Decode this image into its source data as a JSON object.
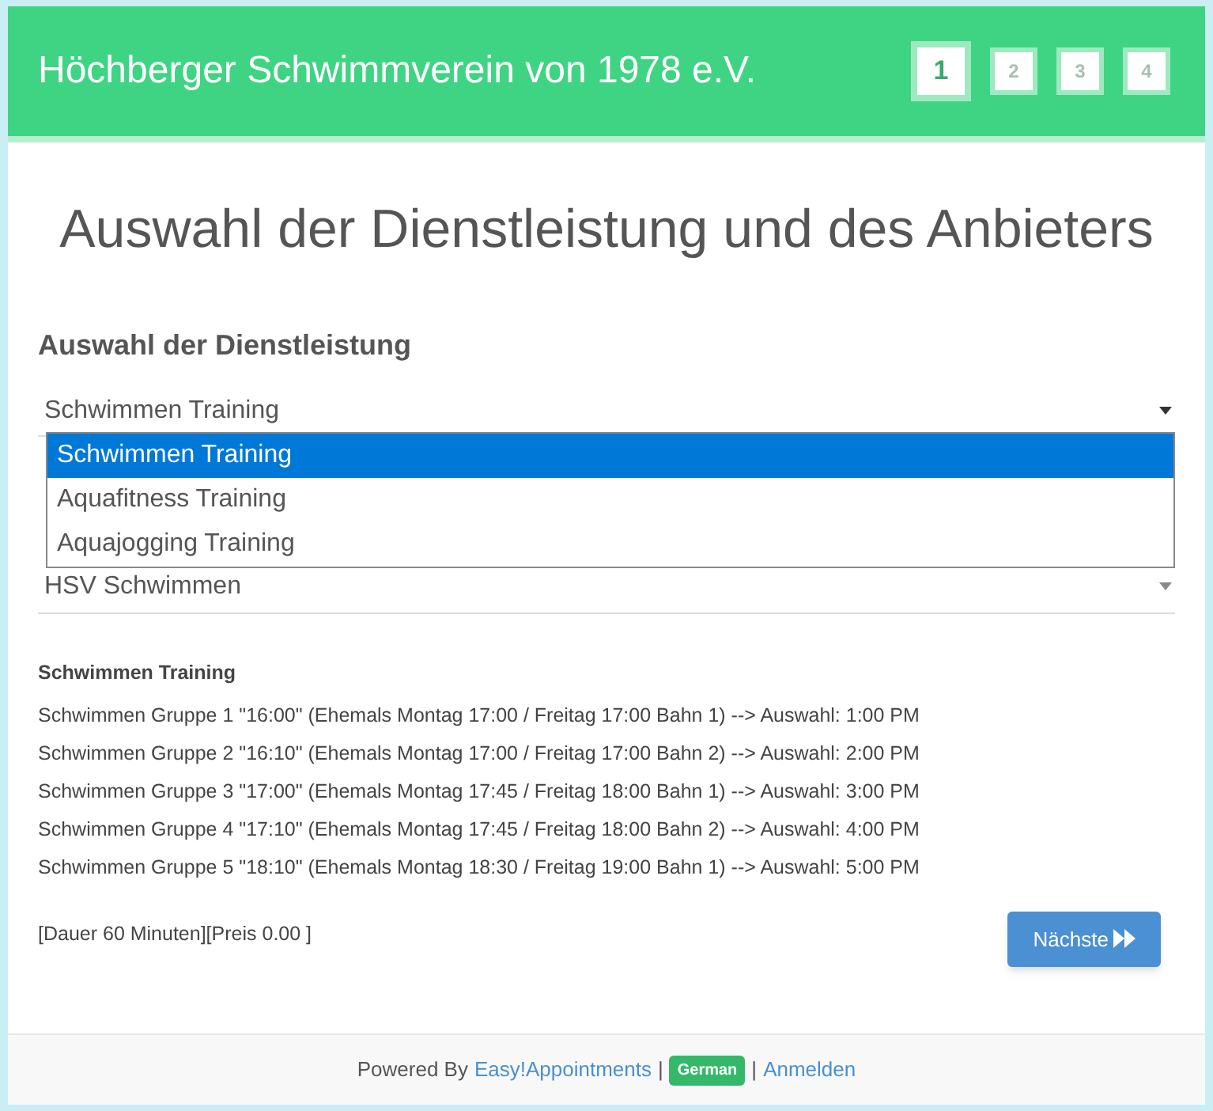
{
  "header": {
    "title": "Höchberger Schwimmverein von 1978 e.V.",
    "steps": [
      {
        "label": "1",
        "selected": true
      },
      {
        "label": "2",
        "selected": false
      },
      {
        "label": "3",
        "selected": false
      },
      {
        "label": "4",
        "selected": false
      }
    ]
  },
  "page_title": "Auswahl der Dienstleistung und des Anbieters",
  "service": {
    "heading": "Auswahl der Dienstleistung",
    "value": "Schwimmen Training",
    "options": [
      {
        "label": "Schwimmen Training",
        "selected": true
      },
      {
        "label": "Aquafitness Training",
        "selected": false
      },
      {
        "label": "Aquajogging Training",
        "selected": false
      }
    ]
  },
  "provider": {
    "value": "HSV Schwimmen"
  },
  "details": {
    "title": "Schwimmen Training",
    "lines": [
      "Schwimmen Gruppe 1 \"16:00\" (Ehemals Montag 17:00 / Freitag 17:00 Bahn 1) --> Auswahl: 1:00 PM",
      "Schwimmen Gruppe 2 \"16:10\" (Ehemals Montag 17:00 / Freitag 17:00 Bahn 2) --> Auswahl: 2:00 PM",
      "Schwimmen Gruppe 3 \"17:00\" (Ehemals Montag 17:45 / Freitag 18:00 Bahn 1) --> Auswahl: 3:00 PM",
      "Schwimmen Gruppe 4 \"17:10\" (Ehemals Montag 17:45 / Freitag 18:00 Bahn 2) --> Auswahl: 4:00 PM",
      "Schwimmen Gruppe 5 \"18:10\" (Ehemals Montag 18:30 / Freitag 19:00 Bahn 1) --> Auswahl: 5:00 PM"
    ],
    "duration_price": "[Dauer 60 Minuten][Preis 0.00 ]"
  },
  "next_button": {
    "label": "Nächste"
  },
  "footer": [
    {
      "kind": "text",
      "text": "Powered By"
    },
    {
      "kind": "link",
      "text": "Easy!Appointments"
    },
    {
      "kind": "text",
      "text": "|"
    },
    {
      "kind": "badge",
      "text": "German"
    },
    {
      "kind": "text",
      "text": "|"
    },
    {
      "kind": "link",
      "text": "Anmelden"
    }
  ]
}
